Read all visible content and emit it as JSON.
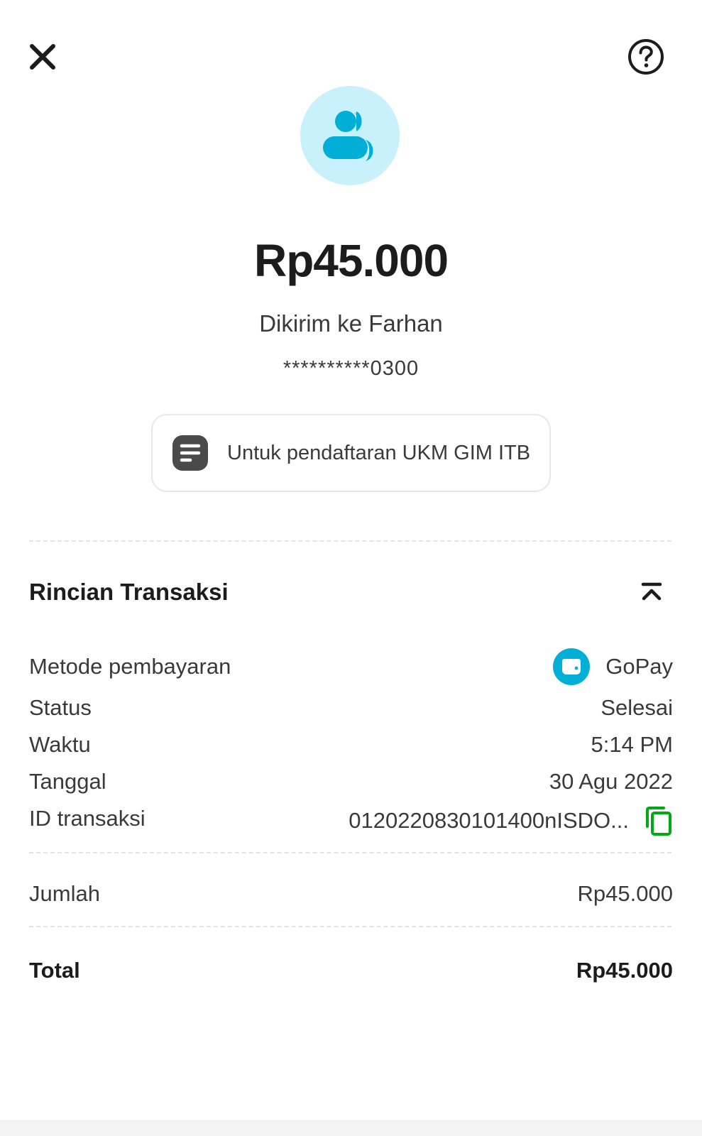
{
  "header": {
    "close_icon": "close-icon",
    "help_icon": "help-circle-icon"
  },
  "recipient_avatar_icon": "people-icon",
  "transfer": {
    "amount": "Rp45.000",
    "recipient_text": "Dikirim ke Farhan",
    "account_number": "**********0300",
    "note_icon": "note-icon",
    "note": "Untuk pendaftaran UKM GIM ITB"
  },
  "details": {
    "title": "Rincian Transaksi",
    "collapse_icon": "chevron-up-icon",
    "payment_method_label": "Metode pembayaran",
    "payment_method_value": "GoPay",
    "payment_method_icon": "wallet-icon",
    "status_label": "Status",
    "status_value": "Selesai",
    "time_label": "Waktu",
    "time_value": "5:14 PM",
    "date_label": "Tanggal",
    "date_value": "30 Agu 2022",
    "txid_label": "ID transaksi",
    "txid_value": "0120220830101400nISDO...",
    "copy_icon": "copy-icon"
  },
  "summary": {
    "amount_label": "Jumlah",
    "amount_value": "Rp45.000",
    "total_label": "Total",
    "total_value": "Rp45.000"
  },
  "colors": {
    "accent_blue": "#00aed6",
    "avatar_bg": "#c9f1fb",
    "copy_green": "#00aa13",
    "text_dark": "#1c1c1c",
    "text_muted": "#3a3a3a"
  }
}
